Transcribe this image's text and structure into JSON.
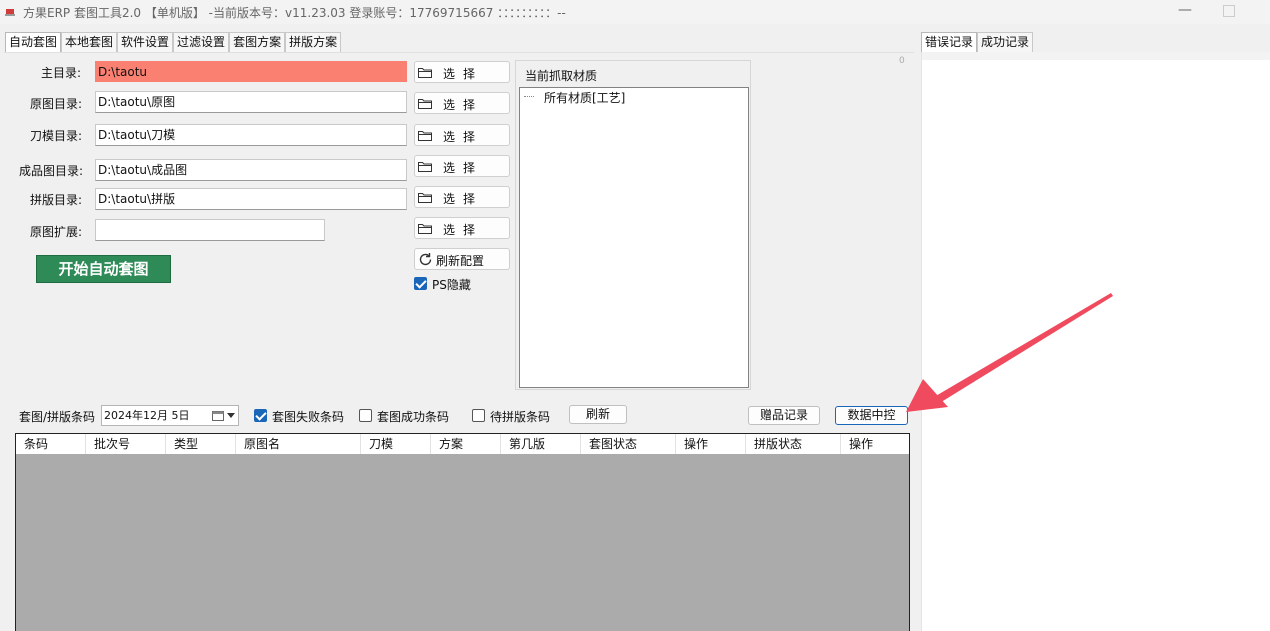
{
  "window": {
    "title": "方果ERP 套图工具2.0 【单机版】 -当前版本号：v11.23.03 登录账号：17769715667 ：：：：：：：：：--",
    "minimize_label": "—"
  },
  "main_tabs": [
    "自动套图",
    "本地套图",
    "软件设置",
    "过滤设置",
    "套图方案",
    "拼版方案"
  ],
  "right_tabs": [
    "错误记录",
    "成功记录"
  ],
  "corner_mark": "0",
  "form": {
    "main_dir": {
      "label": "主目录:",
      "value": "D:\\taotu"
    },
    "original_dir": {
      "label": "原图目录:",
      "value": "D:\\taotu\\原图"
    },
    "die_dir": {
      "label": "刀模目录:",
      "value": "D:\\taotu\\刀模"
    },
    "product_dir": {
      "label": "成品图目录:",
      "value": "D:\\taotu\\成品图"
    },
    "layout_dir": {
      "label": "拼版目录:",
      "value": "D:\\taotu\\拼版"
    },
    "original_ext": {
      "label": "原图扩展:",
      "value": ""
    }
  },
  "select_button_label": "选择",
  "refresh_config_label": "刷新配置",
  "ps_hide": {
    "label": "PS隐藏",
    "checked": true
  },
  "start_button_label": "开始自动套图",
  "material": {
    "title": "当前抓取材质",
    "tree_item": "所有材质[工艺]"
  },
  "filter_bar": {
    "label": "套图/拼版条码",
    "date": "2024年12月  5日",
    "fail_barcode": {
      "label": "套图失败条码",
      "checked": true
    },
    "success_barcode": {
      "label": "套图成功条码",
      "checked": false
    },
    "pending_layout": {
      "label": "待拼版条码",
      "checked": false
    },
    "refresh_label": "刷新",
    "gift_record_label": "赠品记录",
    "data_control_label": "数据中控"
  },
  "table": {
    "columns": [
      "条码",
      "批次号",
      "类型",
      "原图名",
      "刀模",
      "方案",
      "第几版",
      "套图状态",
      "操作",
      "拼版状态",
      "操作"
    ]
  },
  "colors": {
    "highlight_field": "#fa8072",
    "start_button": "#2e8b57",
    "grid_background": "#ababab",
    "arrow": "#f04a5e",
    "checkbox_checked": "#1a66b8"
  }
}
